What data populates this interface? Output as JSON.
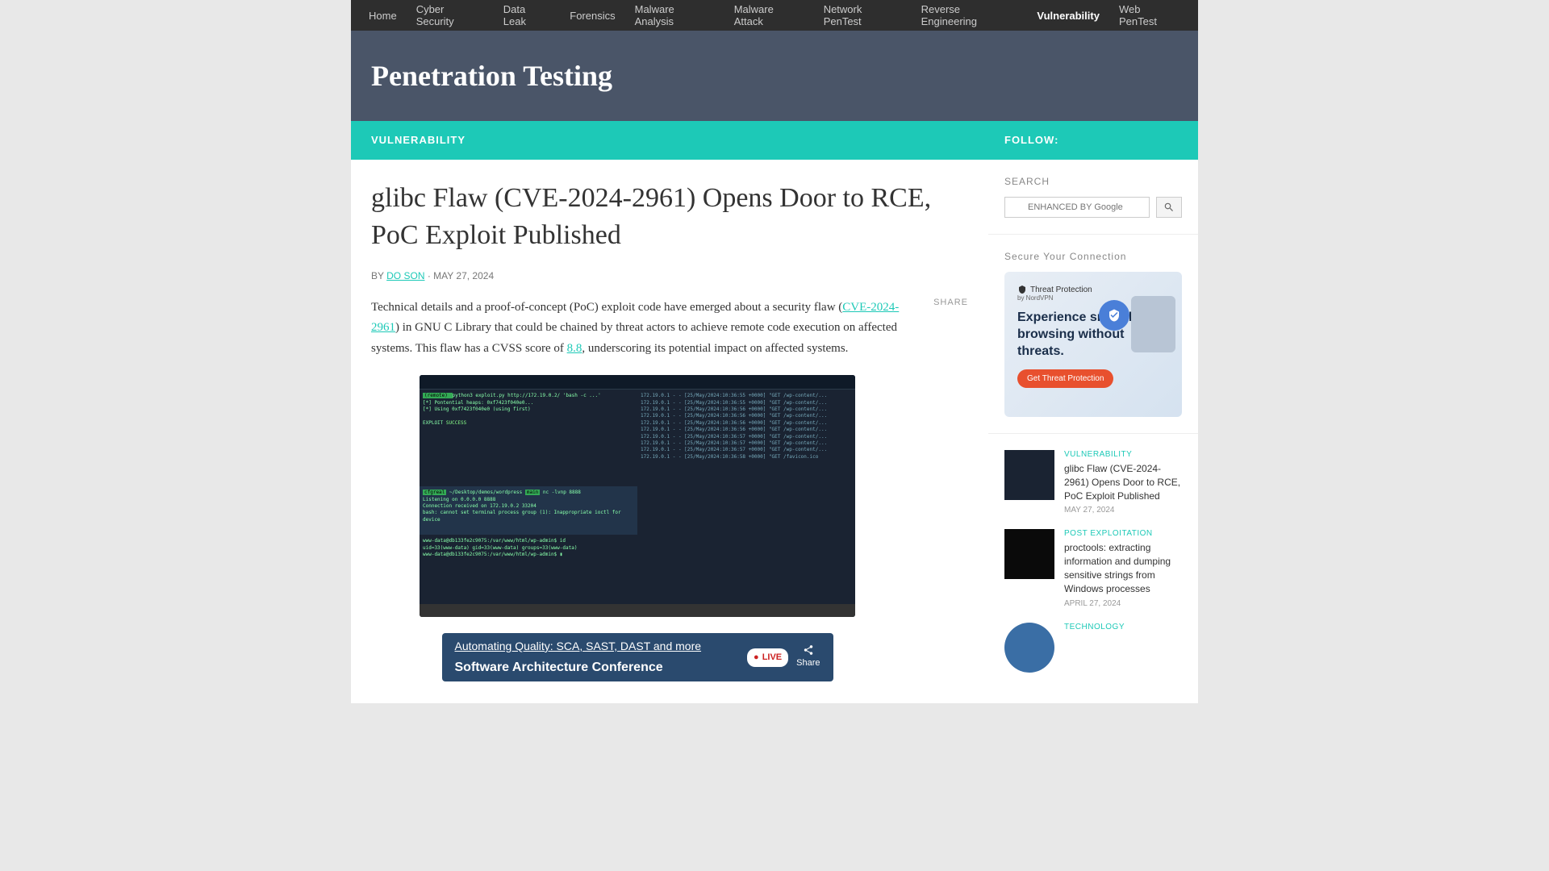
{
  "nav": {
    "items": [
      {
        "label": "Home"
      },
      {
        "label": "Cyber Security"
      },
      {
        "label": "Data Leak"
      },
      {
        "label": "Forensics"
      },
      {
        "label": "Malware Analysis"
      },
      {
        "label": "Malware Attack"
      },
      {
        "label": "Network PenTest"
      },
      {
        "label": "Reverse Engineering"
      },
      {
        "label": "Vulnerability"
      },
      {
        "label": "Web PenTest"
      }
    ],
    "active_index": 8
  },
  "header": {
    "site_title": "Penetration Testing"
  },
  "article": {
    "category": "VULNERABILITY",
    "title": "glibc Flaw (CVE-2024-2961) Opens Door to RCE, PoC Exploit Published",
    "by_label": "BY",
    "author": "DO SON",
    "separator": "·",
    "date": "MAY 27, 2024",
    "share_label": "SHARE",
    "body_parts": {
      "p1a": "Technical details and a proof-of-concept (PoC) exploit code have emerged about a security flaw (",
      "cve_link": "CVE-2024-2961",
      "p1b": ") in GNU C Library that could be chained by threat actors to achieve remote code execution on affected systems. This flaw has a CVSS score of ",
      "score_link": "8.8",
      "p1c": ", underscoring its potential impact on affected systems."
    }
  },
  "video": {
    "title": "Automating Quality: SCA, SAST, DAST and more",
    "subtitle": "Software Architecture Conference",
    "live_label": "LIVE",
    "share_label": "Share"
  },
  "sidebar": {
    "follow_label": "FOLLOW:",
    "search": {
      "title": "SEARCH",
      "placeholder": "ENHANCED BY Google"
    },
    "secure": {
      "title": "Secure Your Connection",
      "brand": "Threat Protection",
      "brand_sub": "by NordVPN",
      "headline": "Experience smooth browsing without threats.",
      "cta": "Get Threat Protection"
    },
    "posts": [
      {
        "category": "VULNERABILITY",
        "title": "glibc Flaw (CVE-2024-2961) Opens Door to RCE, PoC Exploit Published",
        "date": "MAY 27, 2024",
        "thumb_class": ""
      },
      {
        "category": "POST EXPLOITATION",
        "title": "proctools: extracting information and dumping sensitive strings from Windows processes",
        "date": "APRIL 27, 2024",
        "thumb_class": "dark"
      },
      {
        "category": "TECHNOLOGY",
        "title": "",
        "date": "",
        "thumb_class": "blue"
      }
    ]
  }
}
